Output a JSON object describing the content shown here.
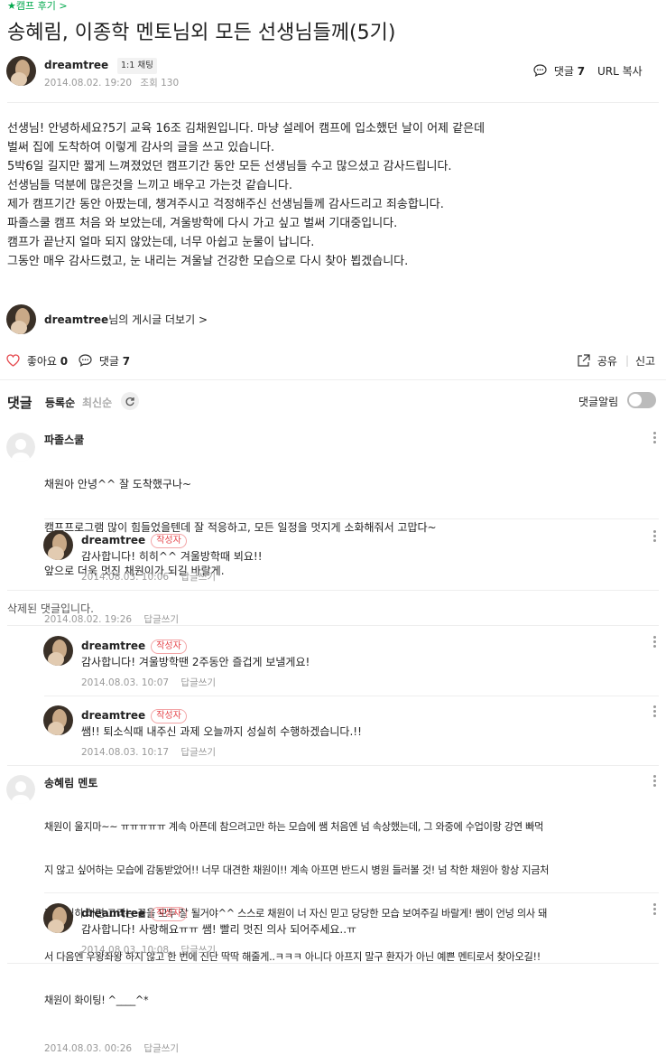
{
  "breadcrumb": {
    "star": "★",
    "label": "캠프 후기",
    "chevron": ">"
  },
  "post": {
    "title": "송혜림, 이종학 멘토님외 모든 선생님들께(5기)",
    "author": "dreamtree",
    "chat_badge": "1:1 채팅",
    "date": "2014.08.02. 19:20",
    "views_label": "조회",
    "views": "130",
    "comment_label": "댓글",
    "comment_count": "7",
    "copy_url": "URL 복사",
    "body": [
      "선생님! 안녕하세요?5기 교육 16조 김채원입니다. 마냥 설레어 캠프에 입소했던 날이 어제 같은데",
      "벌써 집에 도착하여 이렇게 감사의 글을 쓰고 있습니다.",
      "5박6일 길지만 짧게 느껴졌었던 캠프기간 동안 모든 선생님들 수고 많으셨고 감사드립니다.",
      "선생님들 덕분에 많은것을 느끼고 배우고 가는것 같습니다.",
      "제가 캠프기간 동안 아팠는데, 챙겨주시고 걱정해주신 선생님들께 감사드리고 죄송합니다.",
      "파졸스쿨 캠프 처음 와 보았는데, 겨울방학에 다시 가고 싶고 벌써 기대중입니다.",
      "캠프가 끝난지 얼마 되지 않았는데, 너무 아쉽고 눈물이 납니다.",
      "그동안 매우 감사드렸고, 눈 내리는 겨울날 건강한 모습으로 다시 찾아 뵙겠습니다."
    ],
    "more_author": "dreamtree",
    "more_suffix": "님의 게시글 더보기",
    "more_chevron": ">"
  },
  "actions": {
    "like_label": "좋아요",
    "like_count": "0",
    "comment_label": "댓글",
    "comment_count": "7",
    "share": "공유",
    "separator": "|",
    "report": "신고"
  },
  "comments_header": {
    "title": "댓글",
    "sort_registered": "등록순",
    "sort_latest": "최신순",
    "notify_label": "댓글알림",
    "notify_on": false
  },
  "comments": [
    {
      "nick": "파졸스쿨",
      "lines": [
        "채원아 안녕^^ 잘 도착했구나~",
        "캠프프로그램 많이 힘들었을텐데 잘 적응하고, 모든 일정을 멋지게 소화해줘서 고맙다~",
        "앞으로 더욱 멋진 채원이가 되길 바랄게."
      ],
      "date": "2014.08.02. 19:26",
      "reply": "답글쓰기"
    },
    {
      "nick": "dreamtree",
      "badge": "작성자",
      "lines": [
        "감사합니다! 히히^^ 겨울방학때 뵈요!!"
      ],
      "date": "2014.08.03. 10:06",
      "reply": "답글쓰기"
    },
    {
      "deleted": "삭제된 댓글입니다."
    },
    {
      "nick": "dreamtree",
      "badge": "작성자",
      "lines": [
        "감사합니다! 겨울방학땐 2주동안 즐겁게 보낼게요!"
      ],
      "date": "2014.08.03. 10:07",
      "reply": "답글쓰기"
    },
    {
      "nick": "dreamtree",
      "badge": "작성자",
      "lines": [
        "쌤!! 퇴소식때 내주신 과제 오늘까지 성실히 수행하겠습니다.!!"
      ],
      "date": "2014.08.03. 10:17",
      "reply": "답글쓰기"
    },
    {
      "nick": "송혜림 멘토",
      "lines": [
        "채원이 울지마~~ ㅠㅠㅠㅠㅠ 계속 아픈데 참으려고만 하는 모습에 쌤 처음엔 넘 속상했는데, 그 와중에 수업이랑 강연 빠먹",
        "지 않고 싶어하는 모습에 감동받았어!! 너무 대견한 채원이!! 계속 아프면 반드시 병원 들러볼 것! 넘 착한 채원아 항상 지금처",
        "럼 열심히 하면 그리는 꿈을 모두 잘 될거야^^ 스스로 채원이 너 자신 믿고 당당한 모습 보여주길 바랄게! 쌤이 언넝 의사 돼",
        "서 다음엔 우왕좌왕 하지 않고 한 번에 진단 딱딱 해줄게..ㅋㅋㅋ 아니다 아프지 말구 환자가 아닌 예쁜 멘티로서 찾아오길!!",
        "채원이 화이팅! ^____^*"
      ],
      "date": "2014.08.03. 00:26",
      "reply": "답글쓰기"
    },
    {
      "nick": "dreamtree",
      "badge": "작성자",
      "lines": [
        "감사합니다! 사랑해요ㅠㅠ 쌤! 빨리 멋진 의사 되어주세요..ㅠ"
      ],
      "date": "2014.08.03. 10:08",
      "reply": "답글쓰기"
    }
  ]
}
